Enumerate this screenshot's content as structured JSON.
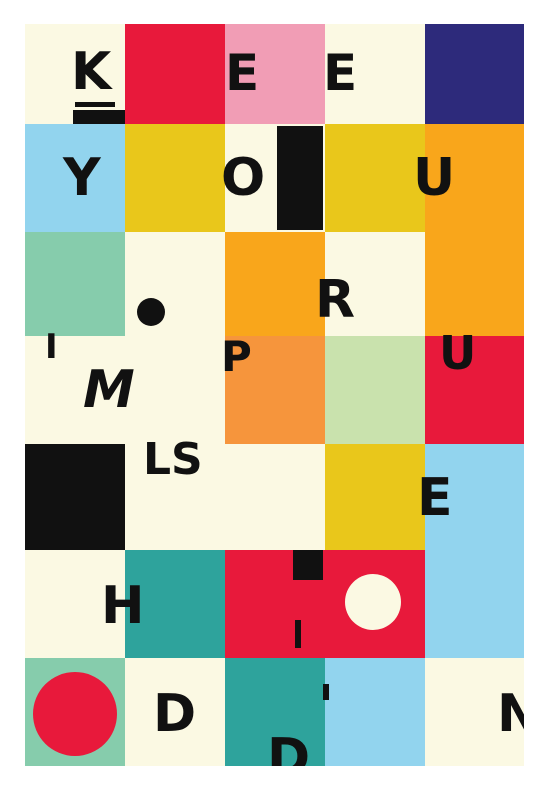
{
  "colors": {
    "cream": "#fbf9e3",
    "red": "#e8193b",
    "pink": "#f19db5",
    "navy": "#2d2a7b",
    "light_blue": "#92d4ee",
    "yellow": "#e9c71b",
    "orange": "#f9a61b",
    "light_orange": "#f6953c",
    "mint": "#86ccac",
    "pale_green": "#c9e2ad",
    "teal": "#2ea39c",
    "black": "#111111"
  },
  "letters": {
    "k": "K",
    "e1": "E",
    "e2": "E",
    "y": "Y",
    "o": "O",
    "u1": "U",
    "r": "R",
    "i": "I",
    "m": "M",
    "p": "P",
    "u2": "U",
    "ls": "LS",
    "e3": "E",
    "h": "H",
    "d": "D",
    "n": "N",
    "d2": "D"
  }
}
